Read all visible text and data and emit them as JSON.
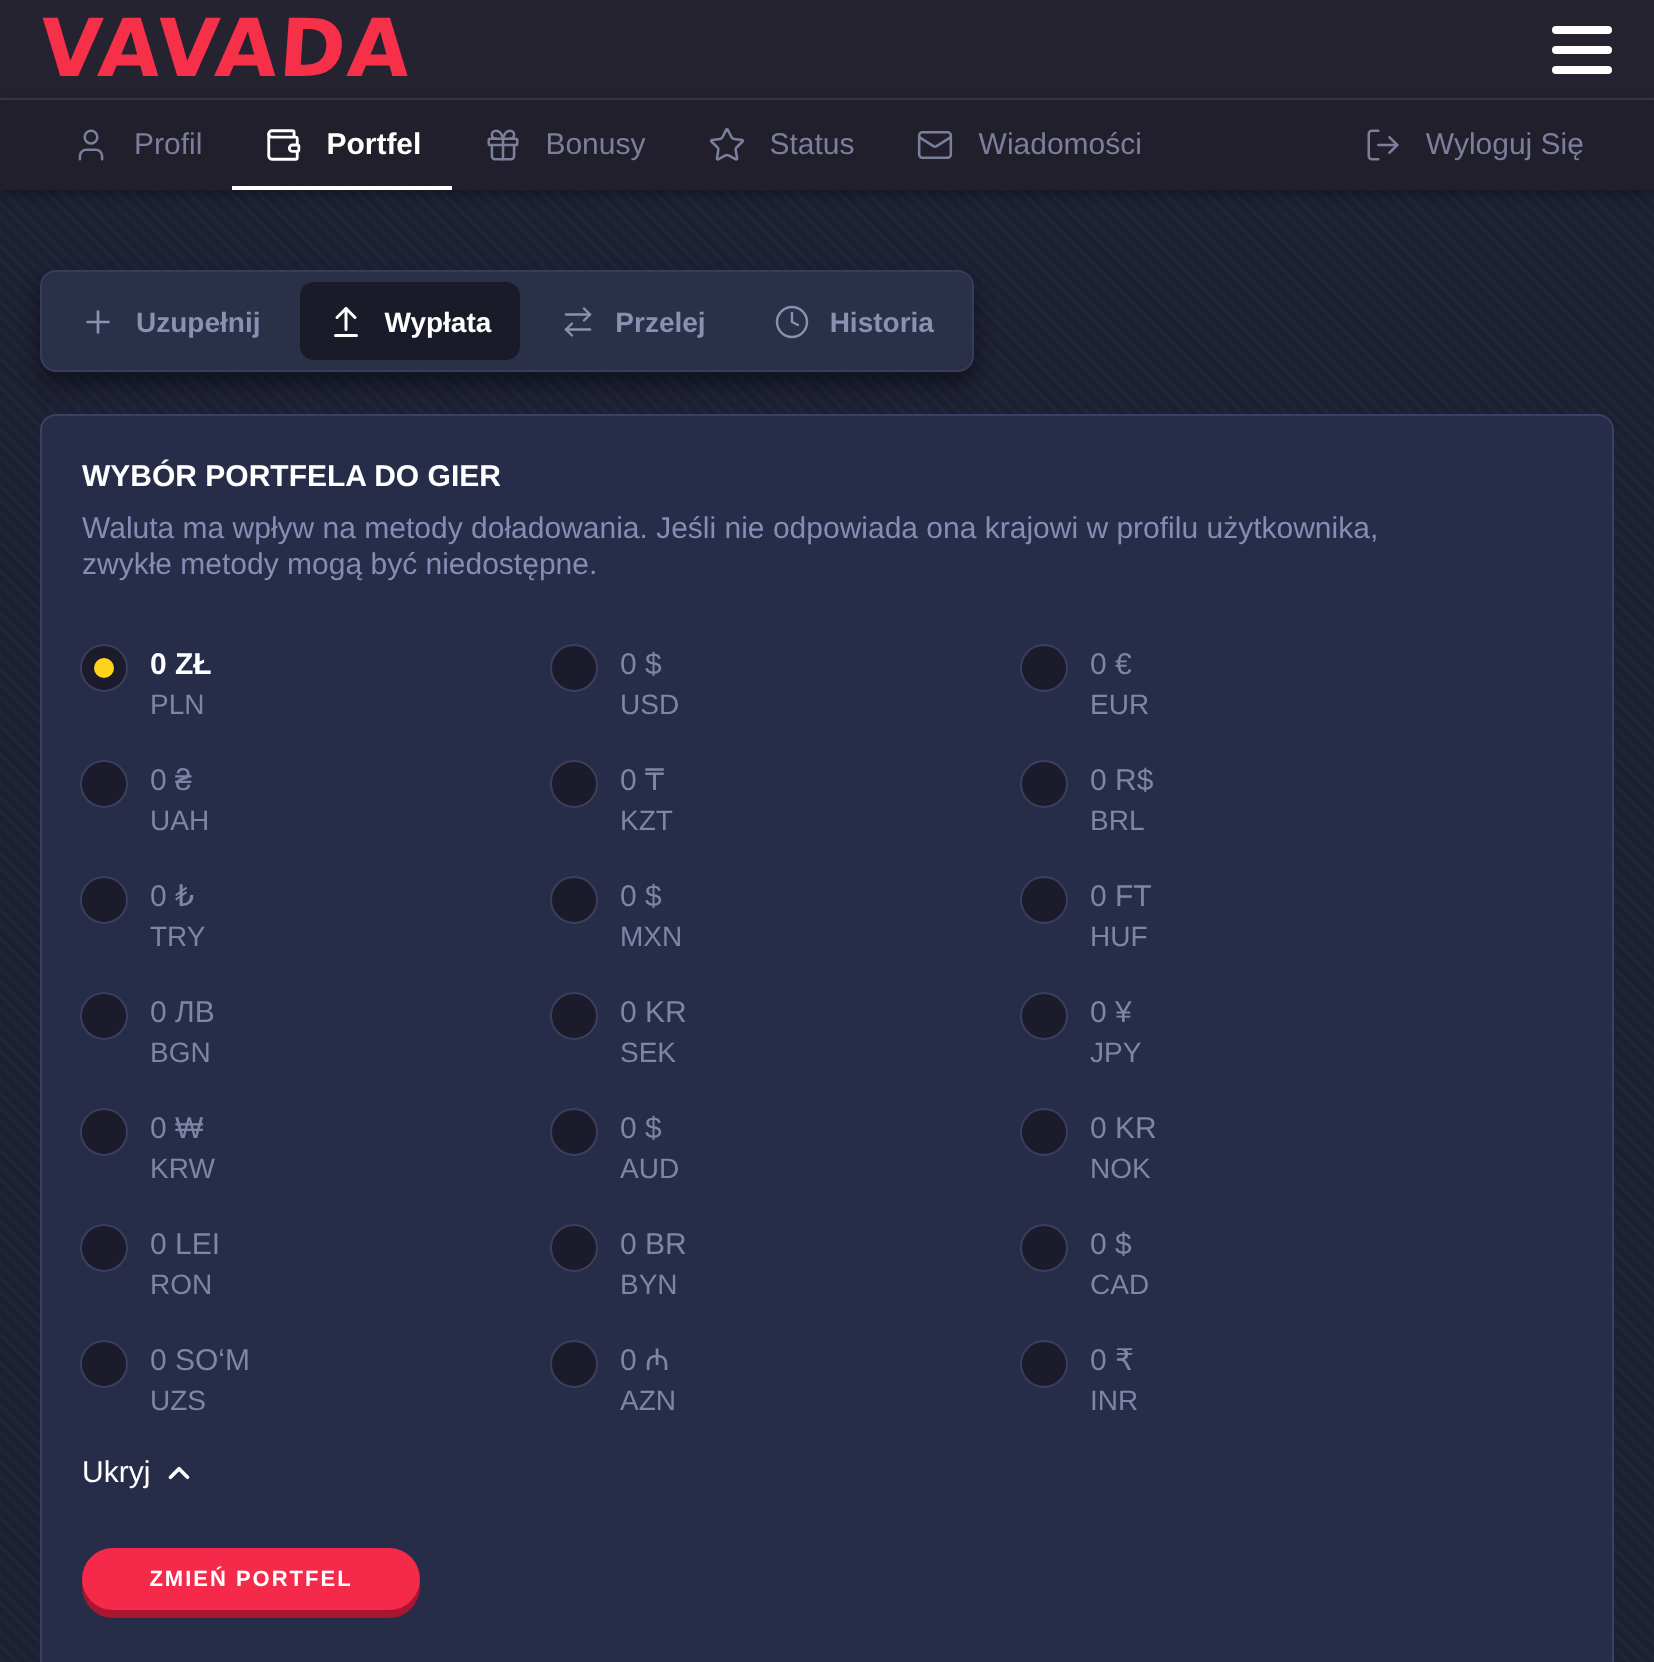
{
  "header": {
    "logo": "VAVADA"
  },
  "nav": {
    "items": [
      {
        "kind": "profile",
        "label": "Profil",
        "selected": false
      },
      {
        "kind": "wallet",
        "label": "Portfel",
        "selected": true
      },
      {
        "kind": "gift",
        "label": "Bonusy",
        "selected": false
      },
      {
        "kind": "star",
        "label": "Status",
        "selected": false
      },
      {
        "kind": "mail",
        "label": "Wiadomości",
        "selected": false
      }
    ],
    "logout": "Wyloguj Się"
  },
  "wallet_tabs": [
    {
      "kind": "deposit",
      "label": "Uzupełnij",
      "selected": false
    },
    {
      "kind": "withdraw",
      "label": "Wypłata",
      "selected": true
    },
    {
      "kind": "transfer",
      "label": "Przelej",
      "selected": false
    },
    {
      "kind": "history",
      "label": "Historia",
      "selected": false
    }
  ],
  "wallet_card": {
    "title": "WYBÓR PORTFELA DO GIER",
    "description": "Waluta ma wpływ na metody doładowania. Jeśli nie odpowiada ona krajowi w profilu użytkownika, zwykłe metody mogą być niedostępne.",
    "currencies": [
      {
        "amount": "0 ZŁ",
        "code": "PLN",
        "selected": true
      },
      {
        "amount": "0 $",
        "code": "USD",
        "selected": false
      },
      {
        "amount": "0 €",
        "code": "EUR",
        "selected": false
      },
      {
        "amount": "0 ₴",
        "code": "UAH",
        "selected": false
      },
      {
        "amount": "0 ₸",
        "code": "KZT",
        "selected": false
      },
      {
        "amount": "0 R$",
        "code": "BRL",
        "selected": false
      },
      {
        "amount": "0 ₺",
        "code": "TRY",
        "selected": false
      },
      {
        "amount": "0 $",
        "code": "MXN",
        "selected": false
      },
      {
        "amount": "0 FT",
        "code": "HUF",
        "selected": false
      },
      {
        "amount": "0 ЛВ",
        "code": "BGN",
        "selected": false
      },
      {
        "amount": "0 KR",
        "code": "SEK",
        "selected": false
      },
      {
        "amount": "0 ¥",
        "code": "JPY",
        "selected": false
      },
      {
        "amount": "0 ₩",
        "code": "KRW",
        "selected": false
      },
      {
        "amount": "0 $",
        "code": "AUD",
        "selected": false
      },
      {
        "amount": "0 KR",
        "code": "NOK",
        "selected": false
      },
      {
        "amount": "0 LEI",
        "code": "RON",
        "selected": false
      },
      {
        "amount": "0 BR",
        "code": "BYN",
        "selected": false
      },
      {
        "amount": "0 $",
        "code": "CAD",
        "selected": false
      },
      {
        "amount": "0 SO‘M",
        "code": "UZS",
        "selected": false
      },
      {
        "amount": "0 ₼",
        "code": "AZN",
        "selected": false
      },
      {
        "amount": "0 ₹",
        "code": "INR",
        "selected": false
      }
    ],
    "toggle": {
      "label": "Ukryj",
      "expanded": true
    },
    "button": "ZMIEŃ PORTFEL"
  }
}
